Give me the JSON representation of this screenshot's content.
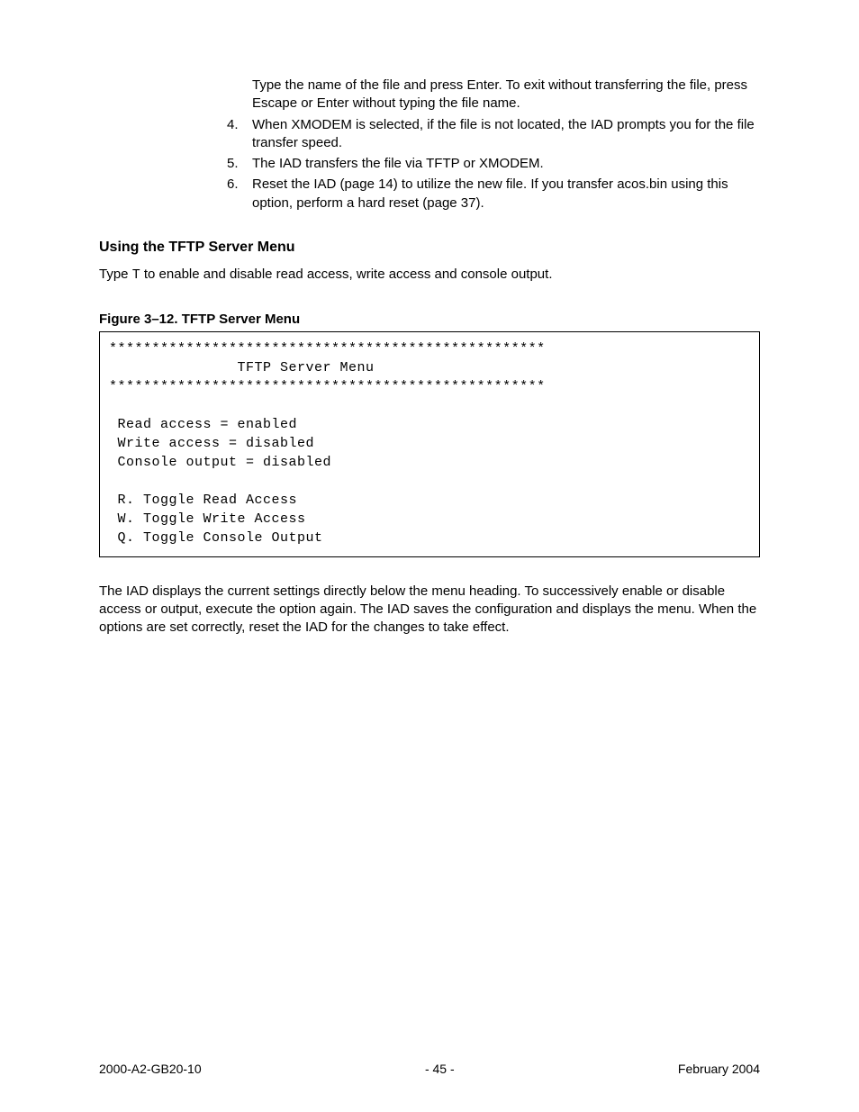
{
  "body": {
    "intro_text": "Type the name of the file and press Enter. To exit without transferring the file, press Escape or Enter without typing the file name.",
    "list_items": [
      {
        "num": "4.",
        "text": "When XMODEM is selected, if the file is not located, the IAD prompts you for the file transfer speed."
      },
      {
        "num": "5.",
        "text": "The IAD transfers the file via TFTP or XMODEM."
      },
      {
        "num": "6.",
        "text": "Reset the IAD (page 14) to utilize the new file. If you transfer acos.bin using this option, perform a hard reset (page 37)."
      }
    ],
    "section_heading": "Using the TFTP Server Menu",
    "section_text_prefix": "Type ",
    "section_text_mono": "T",
    "section_text_suffix": " to enable and disable read access, write access and console output.",
    "figure_caption": "Figure 3–12.  TFTP Server Menu",
    "figure_content": "***************************************************\n               TFTP Server Menu\n***************************************************\n\n Read access = enabled\n Write access = disabled\n Console output = disabled\n\n R. Toggle Read Access\n W. Toggle Write Access\n Q. Toggle Console Output",
    "post_figure_text": "The IAD displays the current settings directly below the menu heading. To successively enable or disable access or output, execute the option again. The IAD saves the configuration and displays the menu. When the options are set correctly, reset the IAD for the changes to take effect."
  },
  "footer": {
    "left": "2000-A2-GB20-10",
    "center": "- 45 -",
    "right": "February 2004"
  }
}
